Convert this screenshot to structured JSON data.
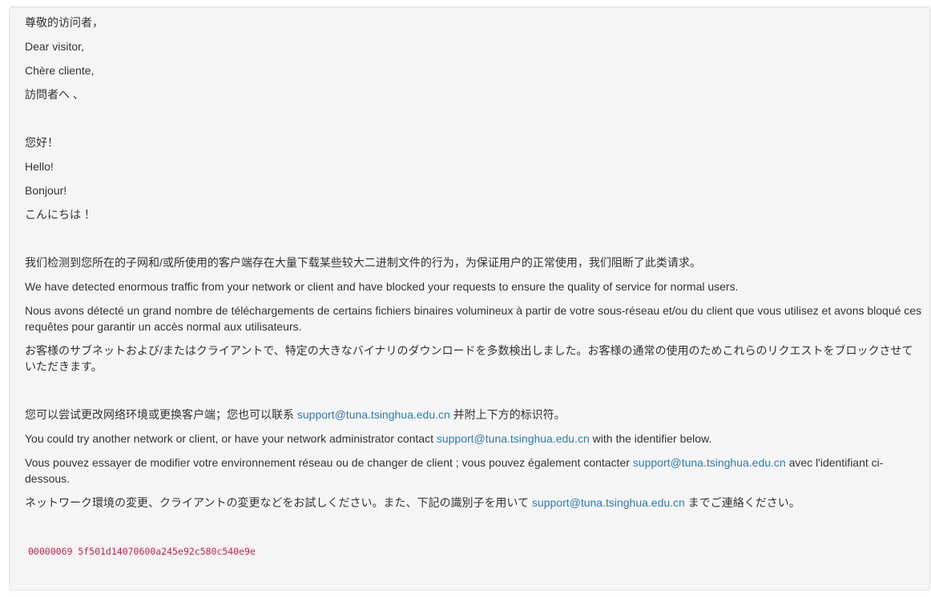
{
  "greetings": {
    "zh": "尊敬的访问者，",
    "en": "Dear visitor,",
    "fr": "Chère cliente,",
    "ja": "訪問者へ 、"
  },
  "hellos": {
    "zh": "您好！",
    "en": "Hello!",
    "fr": "Bonjour!",
    "ja": "こんにちは ！"
  },
  "detected": {
    "zh": "我们检测到您所在的子网和/或所使用的客户端存在大量下载某些较大二进制文件的行为，为保证用户的正常使用，我们阻断了此类请求。",
    "en": "We have detected enormous traffic from your network or client and have blocked your requests to ensure the quality of service for normal users.",
    "fr": "Nous avons détecté un grand nombre de téléchargements de certains fichiers binaires volumineux à partir de votre sous-réseau et/ou du client que vous utilisez et avons bloqué ces requêtes pour garantir un accès normal aux utilisateurs.",
    "ja": "お客様のサブネットおよび/またはクライアントで、特定の大きなバイナリのダウンロードを多数検出しました。お客様の通常の使用のためこれらのリクエストをブロックさせていただきます。"
  },
  "contact": {
    "email": "support@tuna.tsinghua.edu.cn",
    "zh_before": "您可以尝试更改网络环境或更换客户端；您也可以联系 ",
    "zh_after": " 并附上下方的标识符。",
    "en_before": "You could try another network or client, or have your network administrator contact ",
    "en_after": " with the identifier below.",
    "fr_before": "Vous pouvez essayer de modifier votre environnement réseau ou de changer de client ; vous pouvez également contacter ",
    "fr_after": " avec l'identifiant ci-dessous.",
    "ja_before": "ネットワーク環境の変更、クライアントの変更などをお試しください。また、下記の識別子を用いて ",
    "ja_after": " までご連絡ください。"
  },
  "identifier": "00000069 5f501d14070600a245e92c580c540e9e",
  "colors": {
    "link": "#337ab7",
    "code_text": "#c7254e",
    "well_background": "#f5f5f5"
  }
}
